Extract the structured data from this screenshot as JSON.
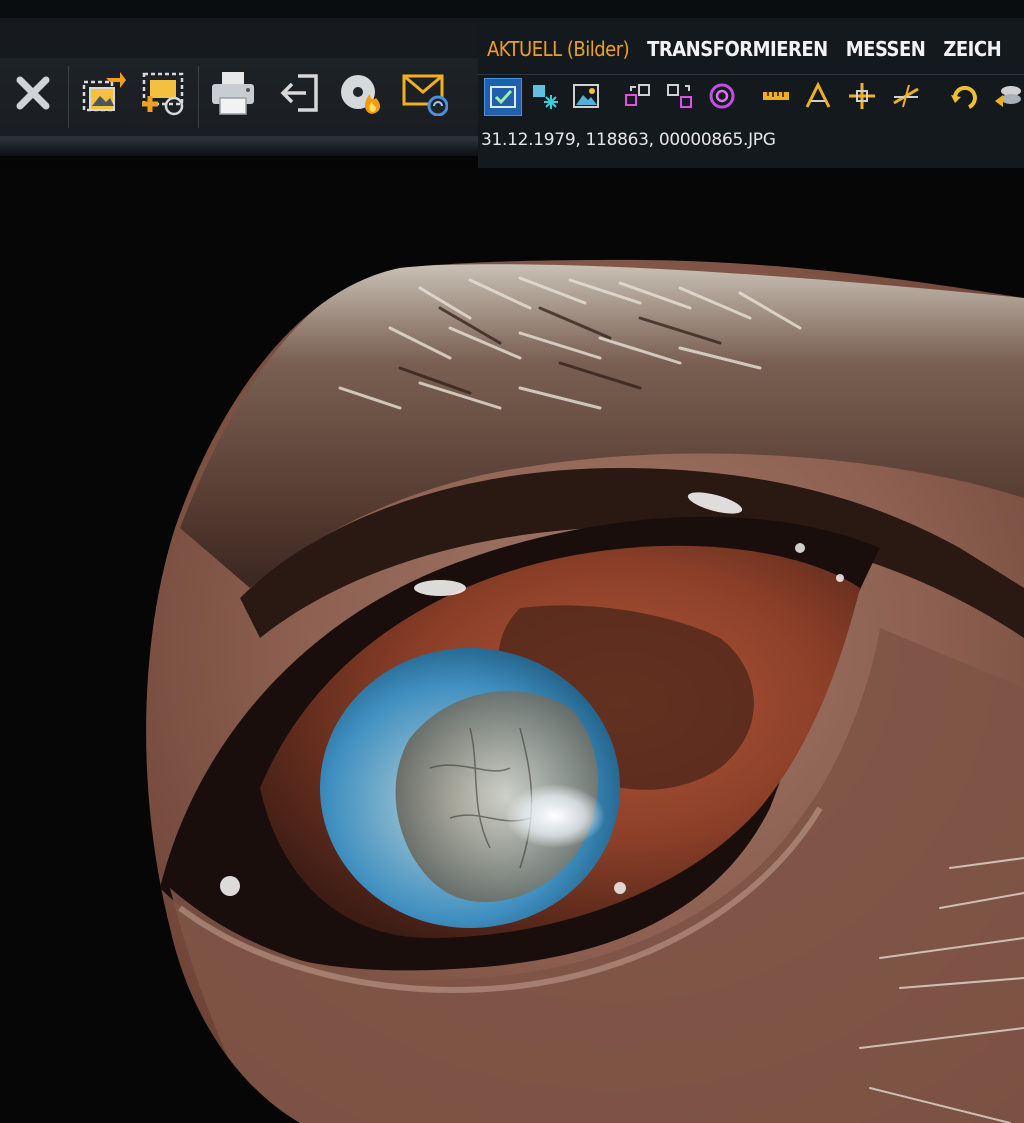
{
  "toolbar": {
    "buttons": [
      {
        "name": "close-icon",
        "label": ""
      },
      {
        "name": "export-image-icon",
        "label": ""
      },
      {
        "name": "add-region-icon",
        "label": ""
      },
      {
        "name": "printer-icon",
        "label": ""
      },
      {
        "name": "exit-icon",
        "label": ""
      },
      {
        "name": "burn-disc-icon",
        "label": ""
      },
      {
        "name": "email-icon",
        "label": ""
      }
    ]
  },
  "ribbon": {
    "tabs": [
      {
        "label": "AKTUELL (Bilder)",
        "active": true
      },
      {
        "label": "TRANSFORMIEREN",
        "active": false
      },
      {
        "label": "MESSEN",
        "active": false
      },
      {
        "label": "ZEICH",
        "active": false
      }
    ],
    "icons": [
      "image-check-icon",
      "image-sparkle-icon",
      "image-view-icon",
      "layout-icon",
      "layout-swap-icon",
      "target-icon",
      "ruler-icon",
      "angle-icon",
      "crosshair-measure-icon",
      "angle-alt-icon",
      "rotate-icon",
      "layers-icon"
    ],
    "image_info": "31.12.1979, 118863, 00000865.JPG"
  },
  "colors": {
    "accent": "#f0a020",
    "selected": "#1f5fae",
    "toolbar_bg": "#1f2429"
  }
}
